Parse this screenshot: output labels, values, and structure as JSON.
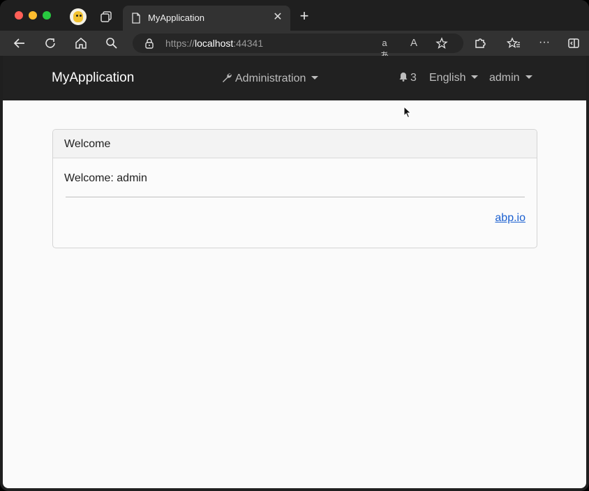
{
  "browser": {
    "tab_title": "MyApplication",
    "tab_close": "✕",
    "new_tab": "+",
    "url_scheme": "https://",
    "url_host": "localhost",
    "url_port": ":44341",
    "translate_icon": "aあ",
    "read_aloud_icon": "A",
    "more_icon": "···"
  },
  "navbar": {
    "brand": "MyApplication",
    "administration": "Administration",
    "notification_count": "3",
    "language": "English",
    "user": "admin"
  },
  "card": {
    "header": "Welcome",
    "welcome": "Welcome: admin",
    "link": "abp.io"
  }
}
